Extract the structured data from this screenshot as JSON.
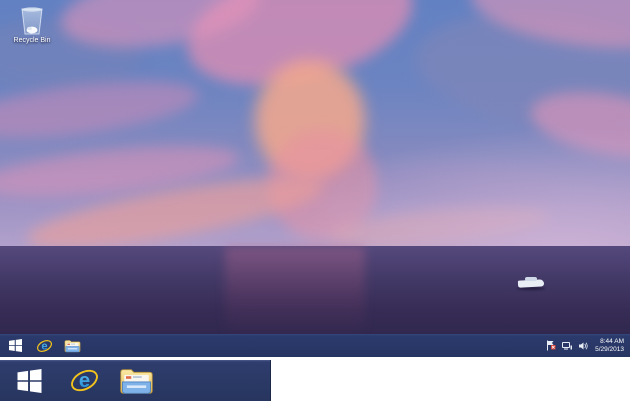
{
  "desktop": {
    "recycle_bin_label": "Recycle Bin",
    "wallpaper_description": "pink sunset clouds over dark purple sea with small white ship"
  },
  "taskbar": {
    "color": "#2b3a6c",
    "start_label": "Start",
    "apps": [
      {
        "name": "Internet Explorer",
        "icon": "internet-explorer-icon"
      },
      {
        "name": "File Explorer",
        "icon": "file-explorer-icon"
      }
    ],
    "tray": {
      "icons": [
        "action-center-flag-icon",
        "network-icon",
        "volume-icon"
      ],
      "clock_time": "8:44 AM",
      "clock_date": "5/29/2013"
    }
  },
  "zoom_strip": {
    "description": "magnified view of taskbar start area",
    "items": [
      {
        "name": "Start",
        "icon": "windows-logo-icon"
      },
      {
        "name": "Internet Explorer",
        "icon": "internet-explorer-icon"
      },
      {
        "name": "File Explorer",
        "icon": "file-explorer-icon"
      }
    ]
  }
}
